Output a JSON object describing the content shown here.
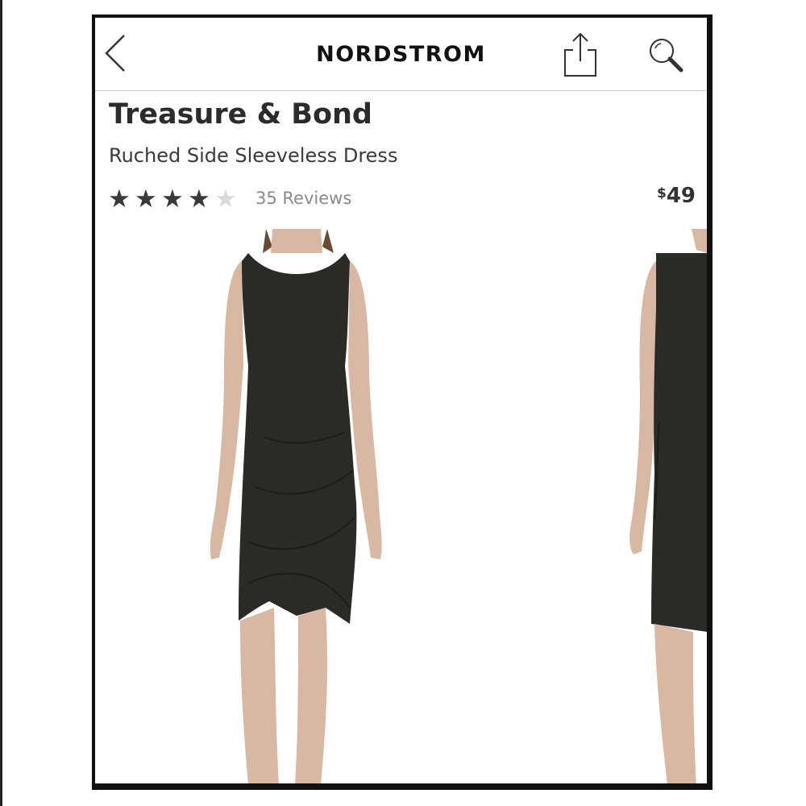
{
  "header": {
    "brand": "NORDSTROM",
    "back_icon": "chevron-left-icon",
    "share_icon": "share-icon",
    "search_icon": "search-icon"
  },
  "product": {
    "brand": "Treasure & Bond",
    "name": "Ruched Side Sleeveless Dress",
    "rating": 4,
    "rating_max": 5,
    "reviews_label": "35 Reviews",
    "price_currency": "$",
    "price_amount": "49"
  },
  "carousel": {
    "images": [
      "model-front-photo",
      "model-side-photo"
    ]
  },
  "colors": {
    "text": "#2b2b2b",
    "muted": "#8a8a8a",
    "star_full": "#3a3a3a",
    "star_empty": "#d9d9d9",
    "dress": "#2a2a27",
    "skin": "#d9b8a3"
  }
}
